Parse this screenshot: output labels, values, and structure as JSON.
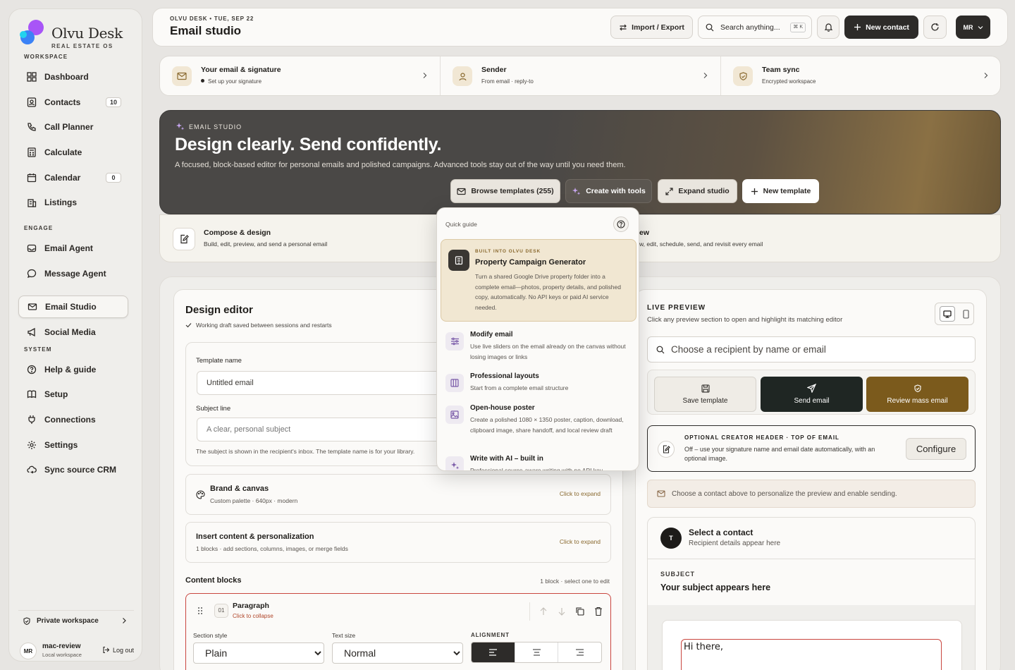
{
  "brand": {
    "name": "Olvu Desk",
    "sub": "REAL ESTATE OS",
    "colors": {
      "violet": "#a855f7",
      "blue": "#3b82f6",
      "cyan": "#22d3ee"
    }
  },
  "sidebar": {
    "workspace_label": "WORKSPACE",
    "engage_label": "ENGAGE",
    "system_label": "SYSTEM",
    "workspace": [
      {
        "label": "Dashboard",
        "icon": "dashboard-icon"
      },
      {
        "label": "Contacts",
        "icon": "contacts-icon",
        "badge": "10"
      },
      {
        "label": "Call Planner",
        "icon": "phone-icon"
      },
      {
        "label": "Calculate",
        "icon": "calculator-icon"
      },
      {
        "label": "Calendar",
        "icon": "calendar-icon",
        "badge": "0"
      },
      {
        "label": "Listings",
        "icon": "building-icon"
      }
    ],
    "engage": [
      {
        "label": "Email Agent",
        "icon": "inbox-icon"
      },
      {
        "label": "Message Agent",
        "icon": "chat-bubble-icon"
      },
      {
        "label": "Email Studio",
        "icon": "mail-icon"
      },
      {
        "label": "Social Media",
        "icon": "megaphone-icon"
      }
    ],
    "system": [
      {
        "label": "Help & guide",
        "icon": "help-icon"
      },
      {
        "label": "Setup",
        "icon": "book-icon"
      },
      {
        "label": "Connections",
        "icon": "plug-icon"
      },
      {
        "label": "Settings",
        "icon": "gear-icon"
      },
      {
        "label": "Sync source CRM",
        "icon": "cloud-sync-icon"
      }
    ],
    "footer": {
      "private_workspace": "Private workspace",
      "user_initials": "MR",
      "user_name": "mac-review",
      "user_sub": "Local workspace",
      "logout": "Log out"
    }
  },
  "topbar": {
    "crumb": "OLVU DESK  •  TUE, SEP 22",
    "title": "Email studio",
    "import_export": "Import / Export",
    "search_placeholder": "Search anything...",
    "search_kbd": "⌘ K",
    "new_contact": "New contact",
    "avatar": "MR"
  },
  "strip": [
    {
      "title": "Your email & signature",
      "sub": "Set up your signature"
    },
    {
      "title": "Sender",
      "sub": "From email · reply-to"
    },
    {
      "title": "Team sync",
      "sub": "Encrypted workspace"
    }
  ],
  "hero": {
    "kicker": "EMAIL STUDIO",
    "title": "Design clearly. Send confidently.",
    "desc": "A focused, block-based editor for personal emails and polished campaigns. Advanced tools stay out of the way until you need them.",
    "browse": "Browse templates (255)",
    "create": "Create with tools",
    "expand": "Expand studio",
    "new_template": "New template"
  },
  "flow": {
    "compose_title": "Compose & design",
    "compose_sub": "Build, edit, preview, and send a personal email",
    "review_title": "ew",
    "review_sub": "w, edit, schedule, send, and revisit every email"
  },
  "popover": {
    "header": "Quick guide",
    "featured": {
      "kicker": "BUILT INTO OLVU DESK",
      "title": "Property Campaign Generator",
      "desc": "Turn a shared Google Drive property folder into a complete email—photos, property details, and polished copy, automatically. No API keys or paid AI service needed."
    },
    "items": [
      {
        "title": "Modify email",
        "desc": "Use live sliders on the email already on the canvas without losing images or links"
      },
      {
        "title": "Professional layouts",
        "desc": "Start from a complete email structure"
      },
      {
        "title": "Open-house poster",
        "desc": "Create a polished 1080 × 1350 poster, caption, download, clipboard image, share handoff, and local review draft"
      },
      {
        "title": "Write with AI – built in",
        "desc": "Professional source-aware writing with no API key"
      }
    ]
  },
  "editor": {
    "title": "Design editor",
    "saved": "Working draft saved between sessions and restarts",
    "template_label": "Template name",
    "template_value": "Untitled email",
    "subject_label": "Subject line",
    "subject_placeholder": "A clear, personal subject",
    "hint": "The subject is shown in the recipient's inbox. The template name is for your library.",
    "brand_title": "Brand & canvas",
    "brand_sub": "Custom palette · 640px · modern",
    "insert_title": "Insert content & personalization",
    "insert_sub": "1 blocks · add sections, columns, images, or merge fields",
    "click_expand": "Click to expand",
    "blocks_title": "Content blocks",
    "blocks_count": "1 block · select one to edit",
    "block": {
      "num": "01",
      "title": "Paragraph",
      "sub": "Click to collapse",
      "style_label": "Section style",
      "style_value": "Plain",
      "size_label": "Text size",
      "size_value": "Normal",
      "align_label": "ALIGNMENT"
    }
  },
  "preview": {
    "kicker": "LIVE PREVIEW",
    "sub": "Click any preview section to open and highlight its matching editor",
    "recipient_placeholder": "Choose a recipient by name or email",
    "save_template": "Save template",
    "send_email": "Send email",
    "review_mass": "Review mass email",
    "creator_kicker": "OPTIONAL CREATOR HEADER · TOP OF EMAIL",
    "creator_desc": "Off – use your signature name and email date automatically, with an optional image.",
    "configure": "Configure",
    "notice": "Choose a contact above to personalize the preview and enable sending.",
    "contact_initial": "T",
    "contact_title": "Select a contact",
    "contact_sub": "Recipient details appear here",
    "subject_key": "SUBJECT",
    "subject_value": "Your subject appears here",
    "greeting": "Hi there,"
  }
}
